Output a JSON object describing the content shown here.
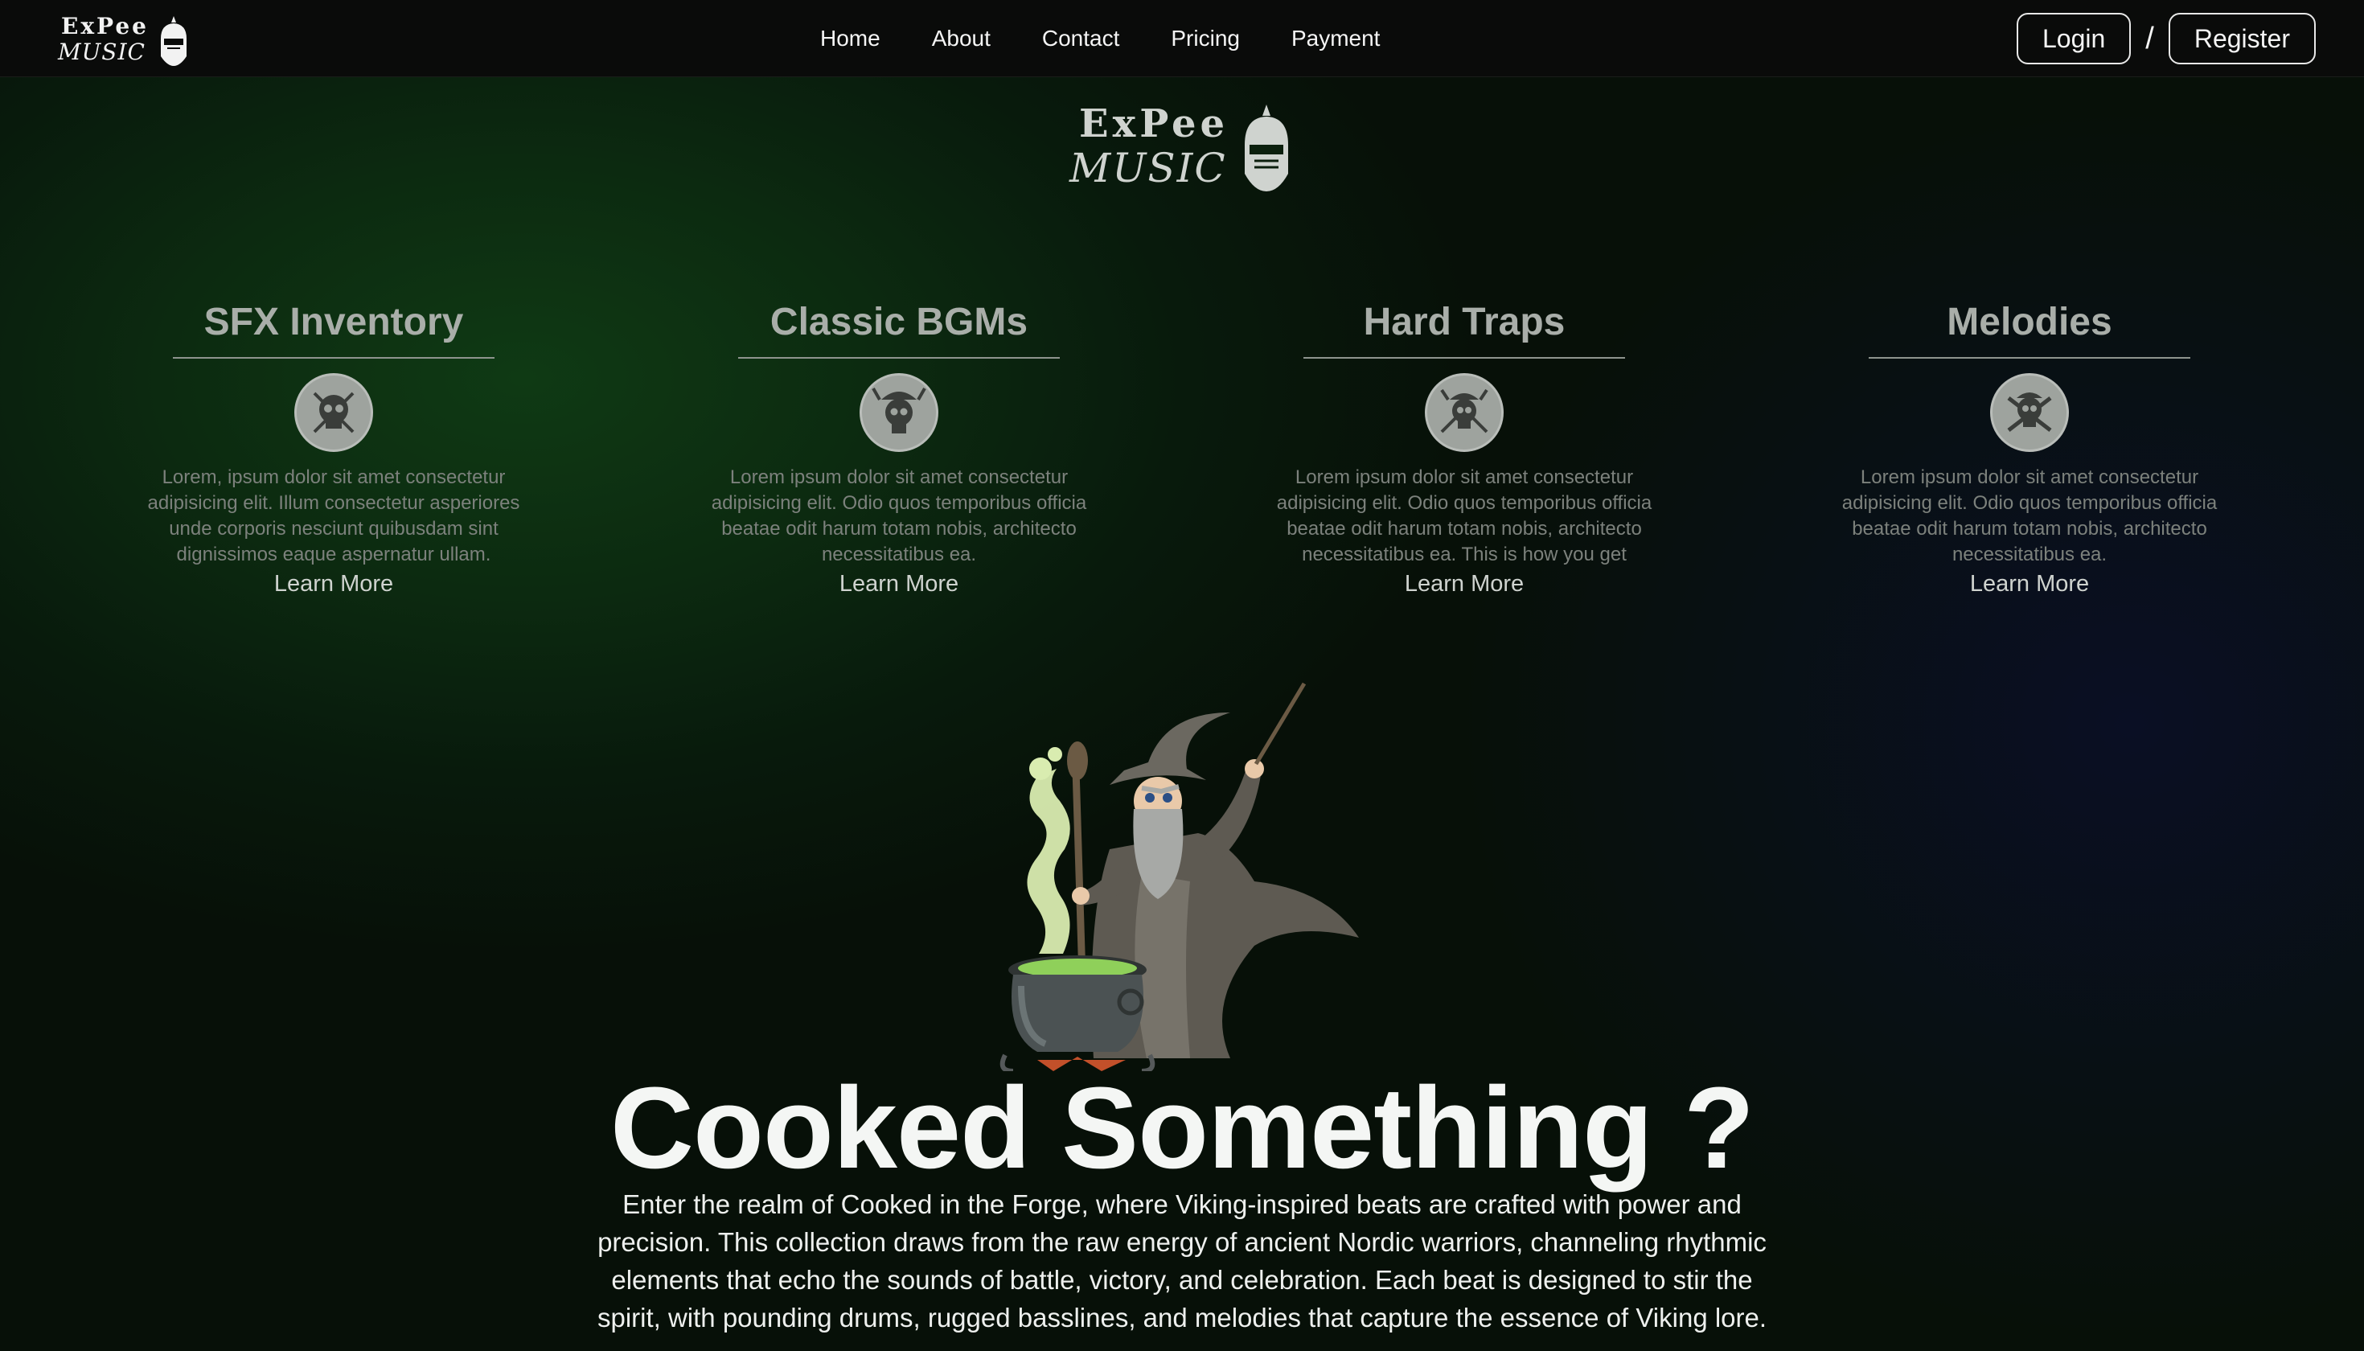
{
  "brand": {
    "line1": "ExPee",
    "line2": "MUSIC"
  },
  "nav": {
    "links": [
      "Home",
      "About",
      "Contact",
      "Pricing",
      "Payment"
    ],
    "login": "Login",
    "separator": "/",
    "register": "Register"
  },
  "categories": [
    {
      "title": "SFX Inventory",
      "icon": "skull-crossed-axes-icon",
      "text": "Lorem, ipsum dolor sit amet consectetur adipisicing elit. Illum consectetur asperiores unde corporis nesciunt quibusdam sint dignissimos eaque aspernatur ullam.",
      "link": "Learn More"
    },
    {
      "title": "Classic BGMs",
      "icon": "viking-skull-icon",
      "text": "Lorem ipsum dolor sit amet consectetur adipisicing elit. Odio quos temporibus officia beatae odit harum totam nobis, architecto necessitatibus ea.",
      "link": "Learn More"
    },
    {
      "title": "Hard Traps",
      "icon": "viking-skull-axes-icon",
      "text": "Lorem ipsum dolor sit amet consectetur adipisicing elit. Odio quos temporibus officia beatae odit harum totam nobis, architecto necessitatibus ea. This is how you get",
      "link": "Learn More"
    },
    {
      "title": "Melodies",
      "icon": "skull-crossbones-icon",
      "text": "Lorem ipsum dolor sit amet consectetur adipisicing elit. Odio quos temporibus officia beatae odit harum totam nobis, architecto necessitatibus ea.",
      "link": "Learn More"
    }
  ],
  "cooked": {
    "title": "Cooked Something ?",
    "text": "Enter the realm of Cooked in the Forge, where Viking-inspired beats are crafted with power and precision. This collection draws from the raw energy of ancient Nordic warriors, channeling rhythmic elements that echo the sounds of battle, victory, and celebration. Each beat is designed to stir the spirit, with pounding drums, rugged basslines, and melodies that capture the essence of Viking lore."
  },
  "colors": {
    "navbar": "#0a0b0a",
    "background_green": "#0f3a14",
    "card_title": "#a9aea9",
    "card_text": "#7c817c",
    "icon_bg": "#9ea39e"
  }
}
